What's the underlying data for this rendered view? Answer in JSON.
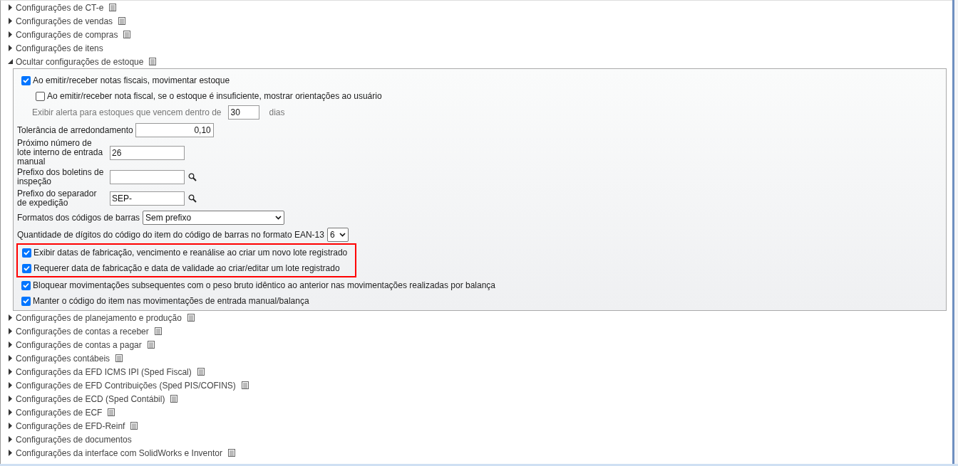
{
  "sections_before": [
    {
      "label": "Configurações de CT-e",
      "expanded": false,
      "doc_icon": true
    },
    {
      "label": "Configurações de vendas",
      "expanded": false,
      "doc_icon": true
    },
    {
      "label": "Configurações de compras",
      "expanded": false,
      "doc_icon": true
    },
    {
      "label": "Configurações de itens",
      "expanded": false,
      "doc_icon": false
    },
    {
      "label": "Ocultar configurações de estoque",
      "expanded": true,
      "doc_icon": true
    }
  ],
  "panel": [
    {
      "kind": "checkbox",
      "label": "Ao emitir/receber notas fiscais, movimentar estoque",
      "checked": true,
      "children": [
        {
          "kind": "checkbox",
          "label": "Ao emitir/receber nota fiscal, se o estoque é insuficiente, mostrar orientações ao usuário",
          "checked": false
        },
        {
          "kind": "number",
          "label": "Exibir alerta para estoques que vencem dentro de",
          "value": "30",
          "unit": "dias",
          "disabled": true
        }
      ]
    },
    {
      "kind": "decimal",
      "label": "Tolerância de arredondamento",
      "value": "0,10"
    },
    {
      "kind": "text",
      "label": "Próximo número de lote interno de entrada manual",
      "value": "26",
      "lookup": false
    },
    {
      "kind": "text",
      "label": "Prefixo dos boletins de inspeção",
      "lookup": true
    },
    {
      "kind": "text",
      "label": "Prefixo do separador de expedição",
      "value": "SEP-",
      "lookup": true
    },
    {
      "kind": "select",
      "label": "Formatos dos códigos de barras",
      "value": "Sem prefixo",
      "wide": true
    },
    {
      "kind": "select",
      "label": "Quantidade de dígitos do código do item do código de barras no formato EAN-13",
      "value": "6",
      "wide": false
    },
    {
      "kind": "highlight",
      "children": [
        {
          "kind": "checkbox",
          "label": "Exibir datas de fabricação, vencimento e reanálise ao criar um novo lote registrado",
          "checked": true
        },
        {
          "kind": "checkbox",
          "label": "Requerer data de fabricação e data de validade ao criar/editar um lote registrado",
          "checked": true
        }
      ]
    },
    {
      "kind": "checkbox",
      "label": "Bloquear movimentações subsequentes com o peso bruto idêntico ao anterior nas movimentações realizadas por balança",
      "checked": true
    },
    {
      "kind": "checkbox",
      "label": "Manter o código do item nas movimentações de entrada manual/balança",
      "checked": true
    }
  ],
  "sections_after": [
    {
      "label": "Configurações de planejamento e produção",
      "expanded": false,
      "doc_icon": true
    },
    {
      "label": "Configurações de contas a receber",
      "expanded": false,
      "doc_icon": true
    },
    {
      "label": "Configurações de contas a pagar",
      "expanded": false,
      "doc_icon": true
    },
    {
      "label": "Configurações contábeis",
      "expanded": false,
      "doc_icon": true
    },
    {
      "label": "Configurações da EFD ICMS IPI (Sped Fiscal)",
      "expanded": false,
      "doc_icon": true
    },
    {
      "label": "Configurações de EFD Contribuições (Sped PIS/COFINS)",
      "expanded": false,
      "doc_icon": true
    },
    {
      "label": "Configurações de ECD (Sped Contábil)",
      "expanded": false,
      "doc_icon": true
    },
    {
      "label": "Configurações de ECF",
      "expanded": false,
      "doc_icon": true
    },
    {
      "label": "Configurações de EFD-Reinf",
      "expanded": false,
      "doc_icon": true
    },
    {
      "label": "Configurações de documentos",
      "expanded": false,
      "doc_icon": false
    },
    {
      "label": "Configurações da interface com SolidWorks e Inventor",
      "expanded": false,
      "doc_icon": true
    }
  ]
}
